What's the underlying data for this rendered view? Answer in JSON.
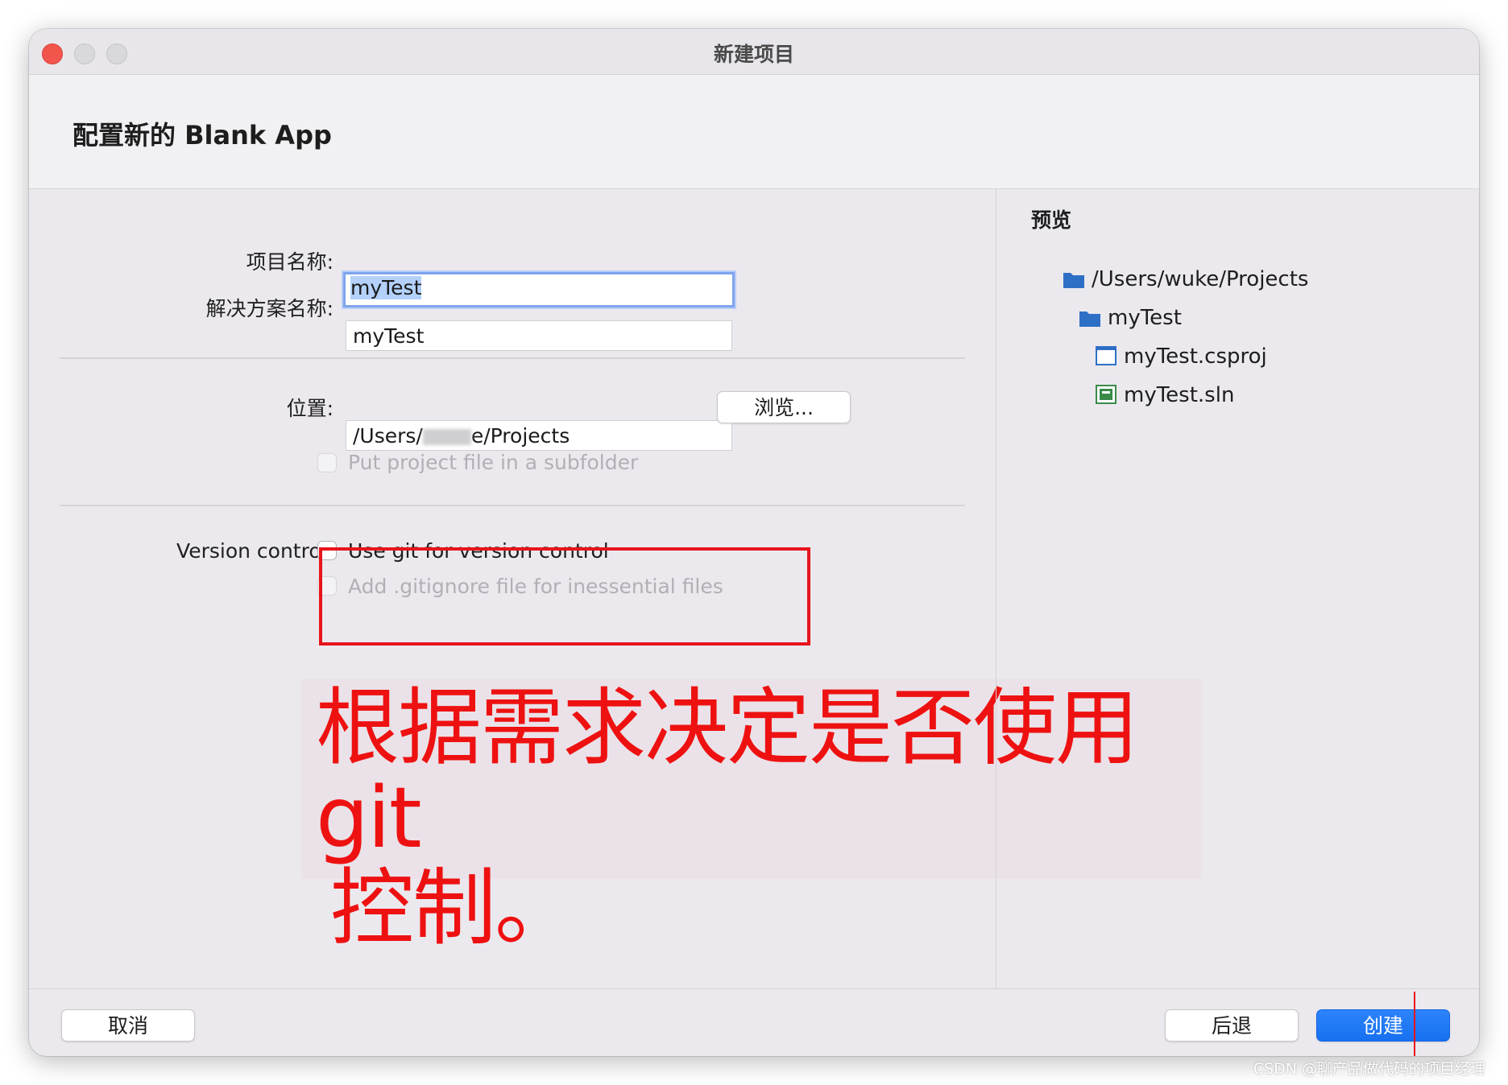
{
  "window": {
    "title": "新建项目"
  },
  "page": {
    "title": "配置新的 Blank App"
  },
  "form": {
    "project_name_label": "项目名称:",
    "project_name_value": "myTest",
    "solution_name_label": "解决方案名称:",
    "solution_name_value": "myTest",
    "location_label": "位置:",
    "location_prefix": "/Users/",
    "location_suffix": "e/Projects",
    "browse_label": "浏览...",
    "subfolder_label": "Put project file in a subfolder",
    "version_control_label": "Version control:",
    "use_git_label": "Use git for version control",
    "gitignore_label": "Add .gitignore file for inessential files"
  },
  "preview": {
    "title": "预览",
    "items": [
      {
        "label": "/Users/wuke/Projects",
        "icon": "folder-icon"
      },
      {
        "label": "myTest",
        "icon": "folder-icon"
      },
      {
        "label": "myTest.csproj",
        "icon": "csproj-file-icon"
      },
      {
        "label": "myTest.sln",
        "icon": "solution-file-icon"
      }
    ]
  },
  "annotation": {
    "line1": "根据需求决定是否使用git",
    "line2": "控制。"
  },
  "footer": {
    "cancel_label": "取消",
    "back_label": "后退",
    "create_label": "创建"
  },
  "watermark": "CSDN @聊产品做代码的项目经理",
  "colors": {
    "accent": "#1670f0",
    "annotation_red": "#ee1111",
    "focus_ring": "#7fa4ee",
    "folder_blue": "#2e6fc6"
  }
}
